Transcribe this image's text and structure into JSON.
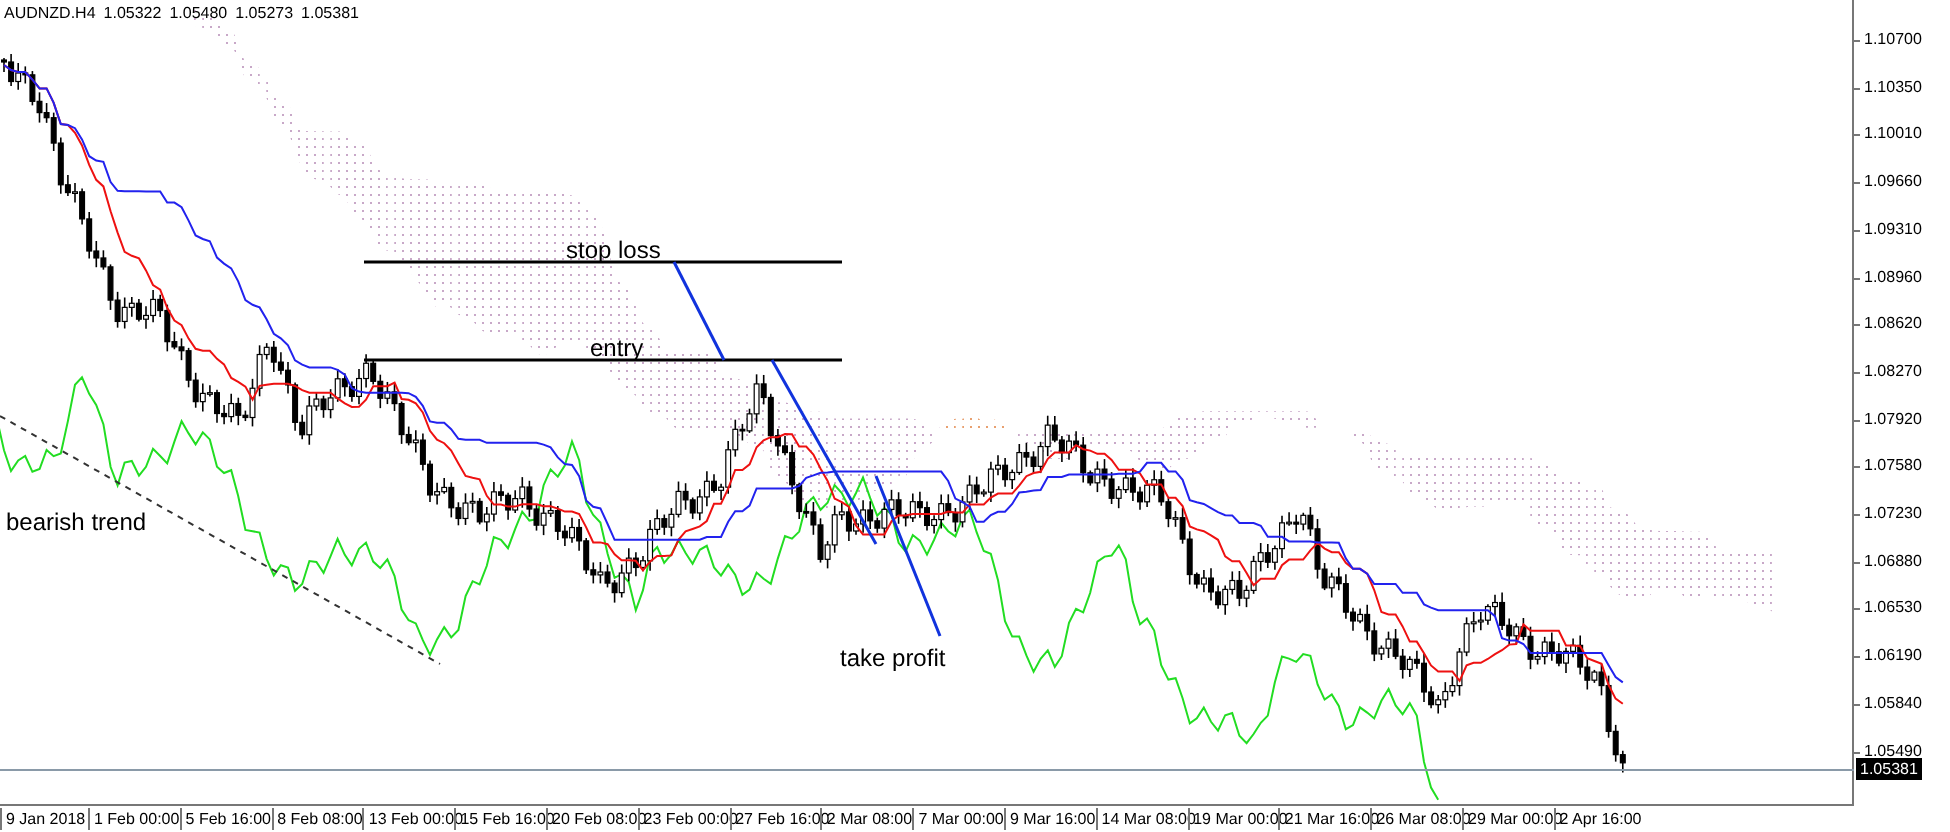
{
  "chart_header": {
    "symbol": "AUDNZD.H4",
    "quotes": [
      "1.05322",
      "1.05480",
      "1.05273",
      "1.05381"
    ]
  },
  "annotations": [
    {
      "kind": "stop",
      "text": "stop loss"
    },
    {
      "kind": "entry",
      "text": "entry"
    },
    {
      "kind": "target",
      "text": "take profit"
    },
    {
      "kind": "trend",
      "text": "bearish trend"
    }
  ],
  "price_axis": {
    "ticks": [
      "1.10700",
      "1.10350",
      "1.10010",
      "1.09660",
      "1.09310",
      "1.08960",
      "1.08620",
      "1.08270",
      "1.07920",
      "1.07580",
      "1.07230",
      "1.06880",
      "1.06530",
      "1.06190",
      "1.05840",
      "1.05490"
    ],
    "current": "1.05381"
  },
  "time_axis": {
    "ticks": [
      "9 Jan 2018",
      "1 Feb 00:00",
      "5 Feb 16:00",
      "8 Feb 08:00",
      "13 Feb 00:00",
      "15 Feb 16:00",
      "20 Feb 08:00",
      "23 Feb 00:00",
      "27 Feb 16:00",
      "2 Mar 08:00",
      "7 Mar 00:00",
      "9 Mar 16:00",
      "14 Mar 08:00",
      "19 Mar 00:00",
      "21 Mar 16:00",
      "26 Mar 08:00",
      "29 Mar 00:00",
      "2 Apr 16:00"
    ]
  }
}
